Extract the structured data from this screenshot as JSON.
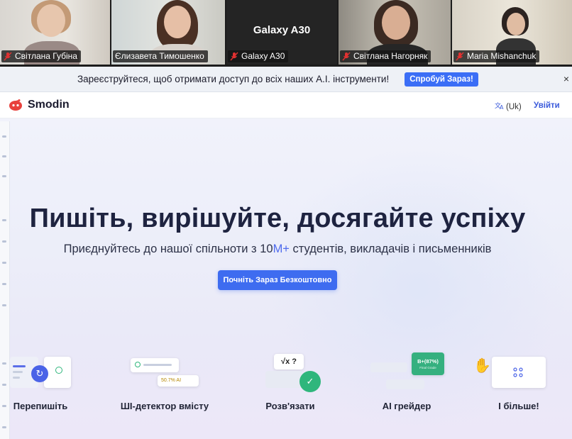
{
  "video": {
    "tiles": [
      {
        "name": "Світлана Губіна",
        "muted": true,
        "active": false
      },
      {
        "name": "Єлизавета Тимошенко",
        "muted": false,
        "active": true
      },
      {
        "name": "Galaxy A30",
        "device_title": "Galaxy A30",
        "muted": true,
        "active": false
      },
      {
        "name": "Світлана Нагорняк",
        "muted": true,
        "active": false
      },
      {
        "name": "Maria Mishanchuk",
        "muted": true,
        "active": false
      }
    ]
  },
  "banner": {
    "text": "Зареєструйтеся, щоб отримати доступ до всіх наших A.I. інструменти!",
    "button": "Спробуй Зараз!",
    "close": "×"
  },
  "header": {
    "logo": "Smodin",
    "language": "(Uk)",
    "login": "Увійти"
  },
  "hero": {
    "title": "Пишіть, вирішуйте, досягайте успіху",
    "subtitle_before": "Приєднуйтесь до нашої спільноти з 10",
    "subtitle_highlight": "M+",
    "subtitle_after": " студентів, викладачів і письменників",
    "cta": "Почніть Зараз Безкоштовно"
  },
  "features": [
    {
      "label": "Перепишіть"
    },
    {
      "label": "ШІ-детектор вмісту",
      "badge": "50.7% AI"
    },
    {
      "label": "Розв'язати",
      "symbol": "√x  ?"
    },
    {
      "label": "AI грейдер",
      "grade": "B+(87%)",
      "grade_sub": "Final Grade"
    },
    {
      "label": "І більше!"
    }
  ],
  "colors": {
    "accent": "#3e6cf0",
    "active_tile": "#4ade80",
    "muted_icon": "#e03131"
  }
}
